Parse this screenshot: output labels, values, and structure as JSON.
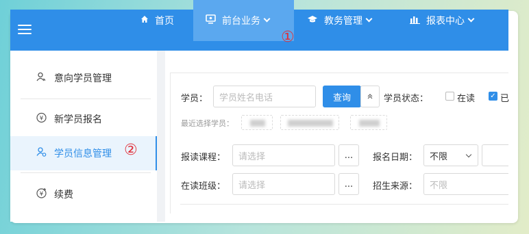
{
  "topbar": {
    "nav": [
      {
        "label": "首页",
        "icon": "home-icon"
      },
      {
        "label": "前台业务",
        "icon": "monitor-icon"
      },
      {
        "label": "教务管理",
        "icon": "graduation-cap-icon"
      },
      {
        "label": "报表中心",
        "icon": "bar-chart-icon"
      }
    ]
  },
  "annotations": {
    "n1": "①",
    "n2": "②"
  },
  "sidebar": {
    "items": [
      {
        "label": "意向学员管理",
        "icon": "person-icon"
      },
      {
        "label": "新学员报名",
        "icon": "yen-icon"
      },
      {
        "label": "学员信息管理",
        "icon": "person-settings-icon"
      },
      {
        "label": "续费",
        "icon": "yen-plus-icon"
      }
    ]
  },
  "form": {
    "student_label": "学员：",
    "student_placeholder": "学员姓名电话",
    "query_label": "查询",
    "collapse_glyph": "»",
    "status_label": "学员状态：",
    "status_opt1": "在读",
    "status_opt2": "已",
    "recent_label": "最近选择学员：",
    "course_label": "报读课程：",
    "course_placeholder": "请选择",
    "dots": "...",
    "signup_date_label": "报名日期：",
    "signup_date_value": "不限",
    "class_label": "在读班级：",
    "class_placeholder": "请选择",
    "source_label": "招生来源：",
    "source_value": "不限"
  },
  "colors": {
    "primary": "#2f8ee8",
    "annotation": "#e0303a"
  }
}
